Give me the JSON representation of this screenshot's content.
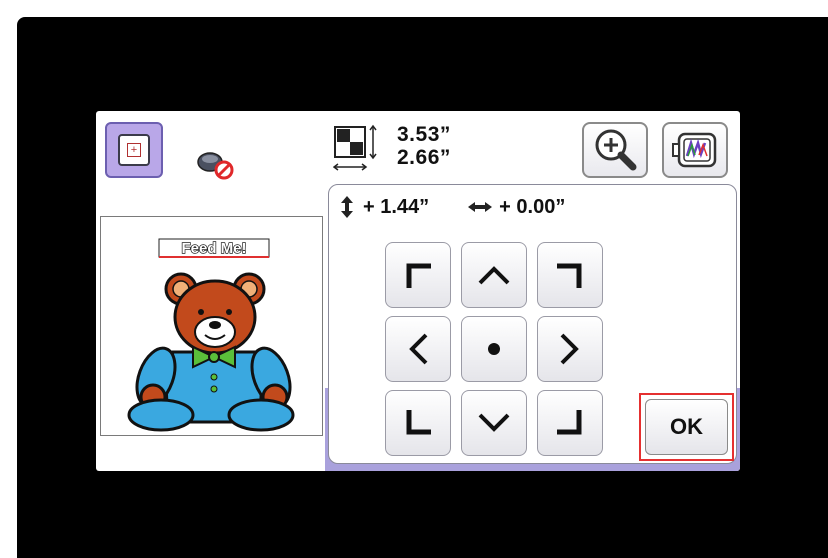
{
  "header": {
    "layout_icon": "plus-square-icon",
    "thread_icon": "thread-spool-no-icon",
    "size_icon": "pattern-size-icon",
    "height_value": "3.53”",
    "width_value": "2.66”",
    "zoom_icon": "magnifier-plus-icon",
    "hoop_icon": "embroidery-hoop-icon"
  },
  "preview": {
    "banner_text": "Feed Me!",
    "image": "teddy-bear-embroidery"
  },
  "position": {
    "vertical_label": "+ 1.44”",
    "horizontal_label": "+ 0.00”"
  },
  "buttons": {
    "ok_label": "OK"
  },
  "colors": {
    "accent_purple": "#a9a1dc",
    "highlight_red": "#e53030",
    "bear_brown": "#c24a1c",
    "shirt_blue": "#3aa8e0",
    "bow_green": "#5abf3a"
  }
}
